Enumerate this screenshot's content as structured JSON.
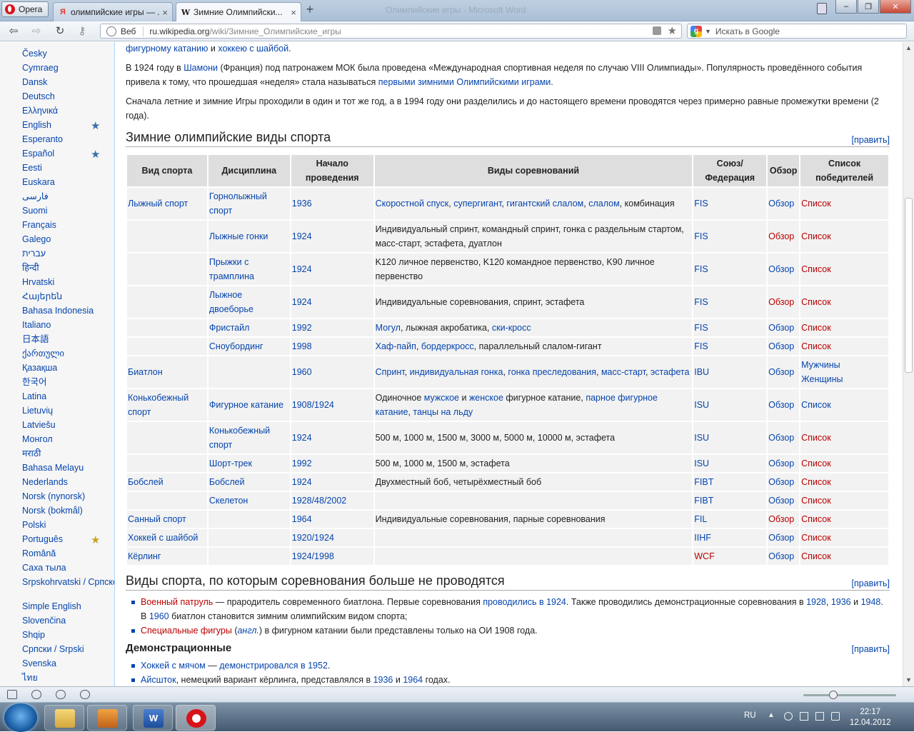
{
  "browser": {
    "menu_label": "Opera",
    "tabs": [
      {
        "label": "олимпийские игры — ...",
        "favicon": "Я",
        "favicon_color": "#e8342a"
      },
      {
        "label": "Зимние Олимпийски...",
        "favicon": "W",
        "favicon_color": "#000000"
      }
    ],
    "window_title": "Олимпийские игры - Microsoft Word",
    "address": {
      "scheme_label": "Веб",
      "host": "ru.wikipedia.org",
      "path": "/wiki/Зимние_Олимпийские_игры"
    },
    "search_placeholder": "Искать в Google"
  },
  "languages": [
    {
      "label": "Česky"
    },
    {
      "label": "Cymraeg"
    },
    {
      "label": "Dansk"
    },
    {
      "label": "Deutsch"
    },
    {
      "label": "Ελληνικά"
    },
    {
      "label": "English",
      "star": "blue"
    },
    {
      "label": "Esperanto"
    },
    {
      "label": "Español",
      "star": "blue"
    },
    {
      "label": "Eesti"
    },
    {
      "label": "Euskara"
    },
    {
      "label": "فارسی"
    },
    {
      "label": "Suomi"
    },
    {
      "label": "Français"
    },
    {
      "label": "Galego"
    },
    {
      "label": "עברית"
    },
    {
      "label": "हिन्दी"
    },
    {
      "label": "Hrvatski"
    },
    {
      "label": "Հայերեն"
    },
    {
      "label": "Bahasa Indonesia"
    },
    {
      "label": "Italiano"
    },
    {
      "label": "日本語"
    },
    {
      "label": "ქართული"
    },
    {
      "label": "Қазақша"
    },
    {
      "label": "한국어"
    },
    {
      "label": "Latina"
    },
    {
      "label": "Lietuvių"
    },
    {
      "label": "Latviešu"
    },
    {
      "label": "Монгол"
    },
    {
      "label": "मराठी"
    },
    {
      "label": "Bahasa Melayu"
    },
    {
      "label": "Nederlands"
    },
    {
      "label": "Norsk (nynorsk)"
    },
    {
      "label": "Norsk (bokmål)"
    },
    {
      "label": "Polski"
    },
    {
      "label": "Português",
      "star": "gold"
    },
    {
      "label": "Română"
    },
    {
      "label": "Саха тыла"
    },
    {
      "label": "Srpskohrvatski / Српскохрватски",
      "two_line": true
    },
    {
      "label": "Simple English"
    },
    {
      "label": "Slovenčina"
    },
    {
      "label": "Shqip"
    },
    {
      "label": "Српски / Srpski"
    },
    {
      "label": "Svenska"
    },
    {
      "label": "ไทย"
    }
  ],
  "article": {
    "intro_fragment": [
      {
        "t": "фигурному катанию",
        "link": true
      },
      {
        "t": " и "
      },
      {
        "t": "хоккею с шайбой",
        "link": true
      },
      {
        "t": "."
      }
    ],
    "para1": [
      {
        "t": "В 1924 году в "
      },
      {
        "t": "Шамони",
        "link": true
      },
      {
        "t": " (Франция) под патронажем МОК была проведена «Международная спортивная неделя по случаю VIII Олимпиады». Популярность проведённого события привела к тому, что прошедшая «неделя» стала называться "
      },
      {
        "t": "первыми зимними Олимпийскими играми",
        "link": true
      },
      {
        "t": "."
      }
    ],
    "para2": [
      {
        "t": "Сначала летние и зимние Игры проходили в один и тот же год, а в 1994 году они разделились и до настоящего времени проводятся через примерно равные промежутки времени (2 года)."
      }
    ],
    "edit_label": "[править]",
    "section1_title": "Зимние олимпийские виды спорта",
    "table": {
      "headers": [
        "Вид спорта",
        "Дисциплина",
        "Начало проведения",
        "Виды соревнований",
        "Союз/ Федерация",
        "Обзор",
        "Список победителей"
      ],
      "rows": [
        {
          "sport": "Лыжный спорт",
          "disc": "Горнолыжный спорт",
          "start": "1936",
          "events": [
            {
              "t": "Скоростной спуск",
              "link": true
            },
            {
              "t": ", "
            },
            {
              "t": "супергигант",
              "link": true
            },
            {
              "t": ", "
            },
            {
              "t": "гигантский слалом",
              "link": true
            },
            {
              "t": ", "
            },
            {
              "t": "слалом",
              "link": true
            },
            {
              "t": ", комбинация"
            }
          ],
          "fed": "FIS",
          "fed_red": false,
          "overview": "Обзор",
          "ov_red": false,
          "winners": "Список"
        },
        {
          "sport": "",
          "disc": "Лыжные гонки",
          "start": "1924",
          "events": [
            {
              "t": "Индивидуальный спринт, командный спринт, гонка с раздельным стартом, масс-старт, эстафета, дуатлон"
            }
          ],
          "fed": "FIS",
          "fed_red": false,
          "overview": "Обзор",
          "ov_red": true,
          "winners": "Список"
        },
        {
          "sport": "",
          "disc": "Прыжки с трамплина",
          "start": "1924",
          "events": [
            {
              "t": "K120 личное первенство, K120 командное первенство, K90 личное первенство"
            }
          ],
          "fed": "FIS",
          "fed_red": false,
          "overview": "Обзор",
          "ov_red": false,
          "winners": "Список"
        },
        {
          "sport": "",
          "disc": "Лыжное двоеборье",
          "start": "1924",
          "events": [
            {
              "t": "Индивидуальные соревнования, спринт, эстафета"
            }
          ],
          "fed": "FIS",
          "fed_red": false,
          "overview": "Обзор",
          "ov_red": true,
          "winners": "Список"
        },
        {
          "sport": "",
          "disc": "Фристайл",
          "start": "1992",
          "events": [
            {
              "t": "Могул",
              "link": true
            },
            {
              "t": ", лыжная акробатика, "
            },
            {
              "t": "ски-кросс",
              "link": true
            }
          ],
          "fed": "FIS",
          "fed_red": false,
          "overview": "Обзор",
          "ov_red": false,
          "winners": "Список"
        },
        {
          "sport": "",
          "disc": "Сноубординг",
          "start": "1998",
          "events": [
            {
              "t": "Хаф-пайп",
              "link": true
            },
            {
              "t": ", "
            },
            {
              "t": "бордеркросс",
              "link": true
            },
            {
              "t": ", параллельный слалом-гигант"
            }
          ],
          "fed": "FIS",
          "fed_red": false,
          "overview": "Обзор",
          "ov_red": false,
          "winners": "Список"
        },
        {
          "sport": "Биатлон",
          "disc": "",
          "start": "1960",
          "events": [
            {
              "t": "Спринт",
              "link": true
            },
            {
              "t": ", "
            },
            {
              "t": "индивидуальная гонка",
              "link": true
            },
            {
              "t": ", "
            },
            {
              "t": "гонка преследования",
              "link": true
            },
            {
              "t": ", "
            },
            {
              "t": "масс-старт",
              "link": true
            },
            {
              "t": ", "
            },
            {
              "t": "эстафета",
              "link": true
            }
          ],
          "fed": "IBU",
          "fed_red": false,
          "overview": "Обзор",
          "ov_red": false,
          "winners": "Мужчины",
          "winners2": "Женщины",
          "win_red": false
        },
        {
          "sport": "Конькобежный спорт",
          "disc": "Фигурное катание",
          "start": "1908/1924",
          "events": [
            {
              "t": "Одиночное "
            },
            {
              "t": "мужское",
              "link": true
            },
            {
              "t": " и "
            },
            {
              "t": "женское",
              "link": true
            },
            {
              "t": " фигурное катание, "
            },
            {
              "t": "парное фигурное катание",
              "link": true
            },
            {
              "t": ", "
            },
            {
              "t": "танцы на льду",
              "link": true
            }
          ],
          "fed": "ISU",
          "fed_red": false,
          "overview": "Обзор",
          "ov_red": false,
          "winners": "Список",
          "win_red": false
        },
        {
          "sport": "",
          "disc": "Конькобежный спорт",
          "start": "1924",
          "events": [
            {
              "t": "500 м, 1000 м, 1500 м, 3000 м, 5000 м, 10000 м, эстафета"
            }
          ],
          "fed": "ISU",
          "fed_red": false,
          "overview": "Обзор",
          "ov_red": false,
          "winners": "Список"
        },
        {
          "sport": "",
          "disc": "Шорт-трек",
          "start": "1992",
          "events": [
            {
              "t": "500 м, 1000 м, 1500 м, эстафета"
            }
          ],
          "fed": "ISU",
          "fed_red": false,
          "overview": "Обзор",
          "ov_red": false,
          "winners": "Список"
        },
        {
          "sport": "Бобслей",
          "disc": "Бобслей",
          "start": "1924",
          "events": [
            {
              "t": "Двухместный боб, четырёхместный боб"
            }
          ],
          "fed": "FIBT",
          "fed_red": false,
          "overview": "Обзор",
          "ov_red": false,
          "winners": "Список"
        },
        {
          "sport": "",
          "disc": "Скелетон",
          "start": "1928/48/2002",
          "events": [],
          "fed": "FIBT",
          "fed_red": false,
          "overview": "Обзор",
          "ov_red": false,
          "winners": "Список"
        },
        {
          "sport": "Санный спорт",
          "disc": "",
          "start": "1964",
          "events": [
            {
              "t": "Индивидуальные соревнования, парные соревнования"
            }
          ],
          "fed": "FIL",
          "fed_red": false,
          "overview": "Обзор",
          "ov_red": true,
          "winners": "Список"
        },
        {
          "sport": "Хоккей с шайбой",
          "disc": "",
          "start": "1920/1924",
          "events": [],
          "fed": "IIHF",
          "fed_red": false,
          "overview": "Обзор",
          "ov_red": false,
          "winners": "Список"
        },
        {
          "sport": "Кёрлинг",
          "disc": "",
          "start": "1924/1998",
          "events": [],
          "fed": "WCF",
          "fed_red": true,
          "overview": "Обзор",
          "ov_red": false,
          "winners": "Список"
        }
      ]
    },
    "section2_title": "Виды спорта, по которым соревнования больше не проводятся",
    "section2_items": [
      [
        {
          "t": "Военный патруль",
          "red": true
        },
        {
          "t": " — прародитель современного биатлона. Первые соревнования "
        },
        {
          "t": "проводились в 1924",
          "link": true
        },
        {
          "t": ". Также проводились демонстрационные соревнования в "
        },
        {
          "t": "1928",
          "link": true
        },
        {
          "t": ", "
        },
        {
          "t": "1936",
          "link": true
        },
        {
          "t": " и "
        },
        {
          "t": "1948",
          "link": true
        },
        {
          "t": ". В "
        },
        {
          "t": "1960",
          "link": true
        },
        {
          "t": " биатлон становится зимним олимпийским видом спорта;"
        }
      ],
      [
        {
          "t": "Специальные фигуры",
          "red": true
        },
        {
          "t": " ("
        },
        {
          "t": "англ.",
          "link": true,
          "italic": true
        },
        {
          "t": ") в фигурном катании были представлены только на ОИ 1908 года."
        }
      ]
    ],
    "section3_title": "Демонстрационные",
    "section3_items": [
      [
        {
          "t": "Хоккей с мячом",
          "link": true
        },
        {
          "t": " — "
        },
        {
          "t": "демонстрировался в 1952",
          "link": true
        },
        {
          "t": "."
        }
      ],
      [
        {
          "t": "Айсшток",
          "link": true
        },
        {
          "t": ", немецкий вариант кёрлинга, представлялся в "
        },
        {
          "t": "1936",
          "link": true
        },
        {
          "t": " и "
        },
        {
          "t": "1964",
          "link": true
        },
        {
          "t": " годах."
        }
      ]
    ]
  },
  "taskbar": {
    "lang": "RU",
    "time": "22:17",
    "date": "12.04.2012"
  }
}
